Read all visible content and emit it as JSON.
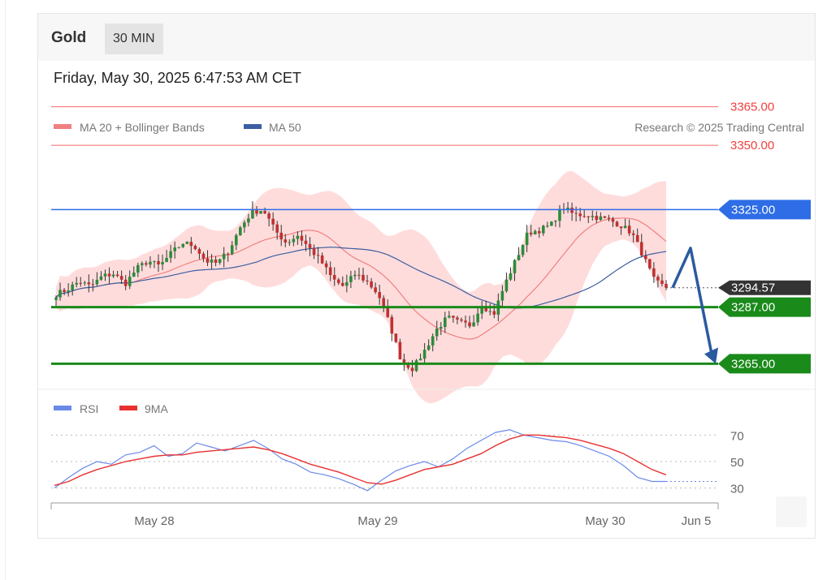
{
  "header": {
    "symbol": "Gold",
    "timeframe": "30 MIN",
    "datetime": "Friday, May 30, 2025 6:47:53 AM CET"
  },
  "legend": {
    "ma20": "MA 20 + Bollinger Bands",
    "ma50": "MA 50",
    "copyright": "Research © 2025 Trading Central",
    "rsi": "RSI",
    "rsi_ma": "9MA"
  },
  "colors": {
    "resistance": "#f04040",
    "pivot": "#2e6de6",
    "support": "#1a8a1a",
    "bollinger": "#ffd6d6",
    "ma20": "#f08080",
    "ma50": "#3b5fa0",
    "current": "#333333",
    "candle_up": "#2e8b3a",
    "candle_down": "#c03030",
    "rsi": "#6a8ae8",
    "rsi_ma": "#e83030",
    "arrow": "#2a5aa0"
  },
  "chart_data": [
    {
      "type": "candlestick",
      "title": "Gold",
      "x_ticks": [
        "May 28",
        "May 29",
        "May 30",
        "Jun 5"
      ],
      "ylim": [
        3255,
        3375
      ],
      "levels": [
        {
          "label": "3365.00",
          "value": 3365.0,
          "kind": "resistance"
        },
        {
          "label": "3350.00",
          "value": 3350.0,
          "kind": "resistance"
        },
        {
          "label": "3325.00",
          "value": 3325.0,
          "kind": "pivot"
        },
        {
          "label": "3294.57",
          "value": 3294.57,
          "kind": "current"
        },
        {
          "label": "3287.00",
          "value": 3287.0,
          "kind": "support"
        },
        {
          "label": "3265.00",
          "value": 3265.0,
          "kind": "support"
        }
      ],
      "close_path": [
        3292,
        3294,
        3297,
        3295,
        3299,
        3300,
        3296,
        3302,
        3305,
        3303,
        3308,
        3312,
        3311,
        3305,
        3304,
        3309,
        3318,
        3324,
        3325,
        3317,
        3312,
        3315,
        3310,
        3305,
        3298,
        3295,
        3300,
        3297,
        3292,
        3280,
        3266,
        3263,
        3270,
        3278,
        3283,
        3281,
        3280,
        3288,
        3284,
        3296,
        3306,
        3316,
        3317,
        3319,
        3326,
        3323,
        3323,
        3322,
        3321,
        3319,
        3316,
        3307,
        3297,
        3294.57
      ],
      "forecast": [
        3294.57,
        3310,
        3265
      ]
    },
    {
      "type": "line",
      "title": "RSI",
      "y_ticks": [
        30,
        50,
        70
      ],
      "ylim": [
        20,
        80
      ],
      "series": [
        {
          "name": "RSI",
          "values": [
            30,
            38,
            45,
            50,
            48,
            55,
            57,
            62,
            54,
            56,
            64,
            61,
            58,
            62,
            66,
            60,
            52,
            48,
            42,
            40,
            37,
            33,
            28,
            36,
            43,
            47,
            50,
            46,
            52,
            60,
            66,
            72,
            74,
            70,
            68,
            66,
            65,
            62,
            58,
            54,
            47,
            38,
            35,
            35
          ]
        },
        {
          "name": "9MA",
          "values": [
            32,
            35,
            40,
            44,
            47,
            50,
            52,
            54,
            55,
            55,
            57,
            58,
            59,
            60,
            61,
            59,
            56,
            52,
            48,
            45,
            42,
            38,
            34,
            33,
            36,
            40,
            44,
            46,
            48,
            52,
            56,
            62,
            67,
            70,
            70,
            69,
            68,
            66,
            63,
            60,
            56,
            50,
            44,
            40
          ]
        }
      ]
    }
  ]
}
